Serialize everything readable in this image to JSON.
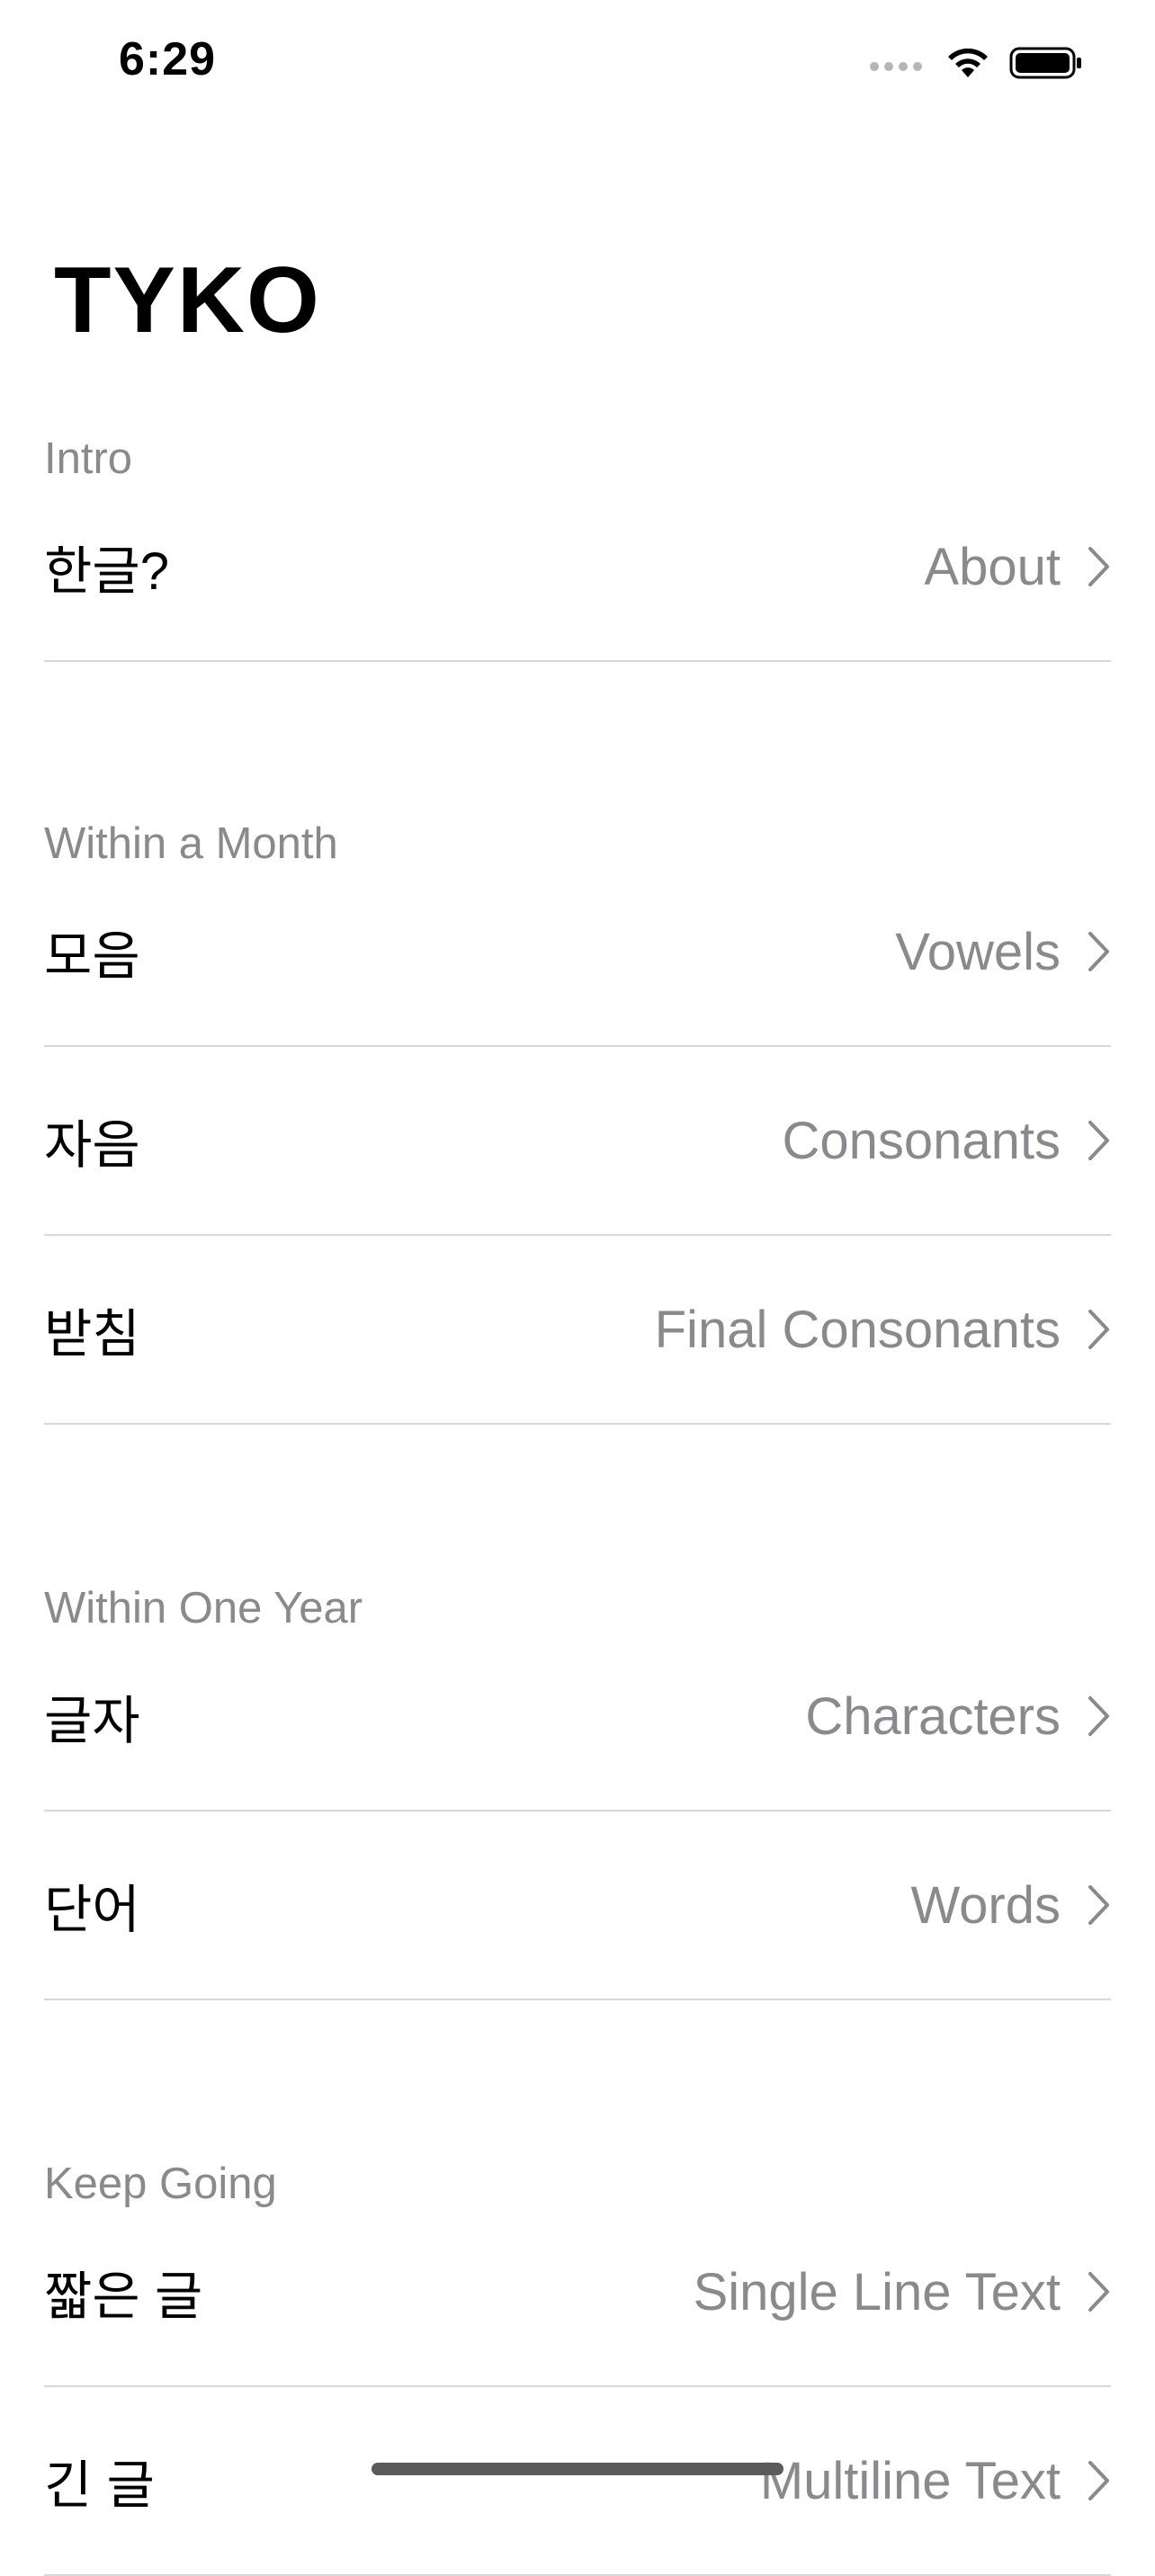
{
  "status_bar": {
    "time": "6:29"
  },
  "app": {
    "title": "TYKO"
  },
  "sections": [
    {
      "header": "Intro",
      "rows": [
        {
          "title": "한글?",
          "detail": "About"
        }
      ]
    },
    {
      "header": "Within a Month",
      "rows": [
        {
          "title": "모음",
          "detail": "Vowels"
        },
        {
          "title": "자음",
          "detail": "Consonants"
        },
        {
          "title": "받침",
          "detail": "Final Consonants"
        }
      ]
    },
    {
      "header": "Within One Year",
      "rows": [
        {
          "title": "글자",
          "detail": "Characters"
        },
        {
          "title": "단어",
          "detail": "Words"
        }
      ]
    },
    {
      "header": "Keep Going",
      "rows": [
        {
          "title": "짧은 글",
          "detail": "Single Line Text"
        },
        {
          "title": "긴 글",
          "detail": "Multiline Text"
        }
      ]
    }
  ],
  "icons": {
    "row_disclosure": "chevron-right-icon"
  },
  "colors": {
    "secondary_text": "#8a8a8e",
    "separator": "#d9d9dc",
    "background": "#ffffff"
  }
}
